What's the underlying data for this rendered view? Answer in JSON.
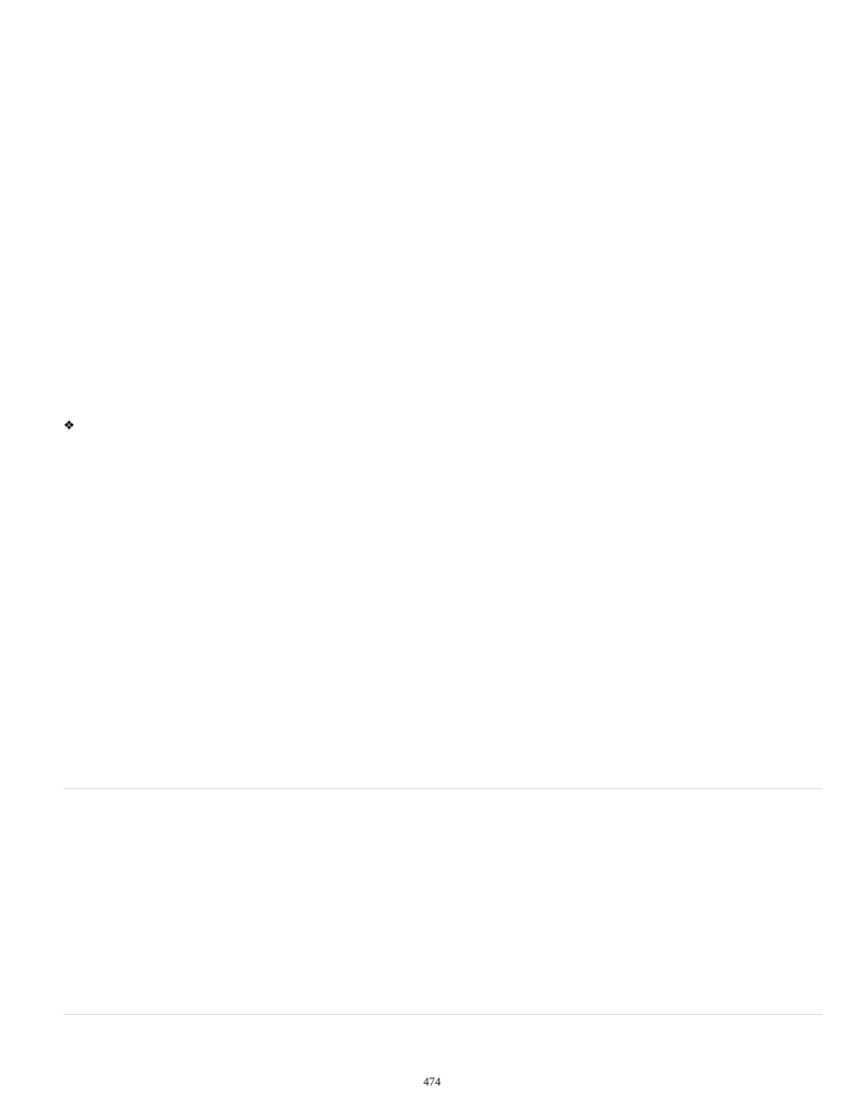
{
  "bullet": {
    "glyph": "❖"
  },
  "footer": {
    "page_number": "474"
  }
}
